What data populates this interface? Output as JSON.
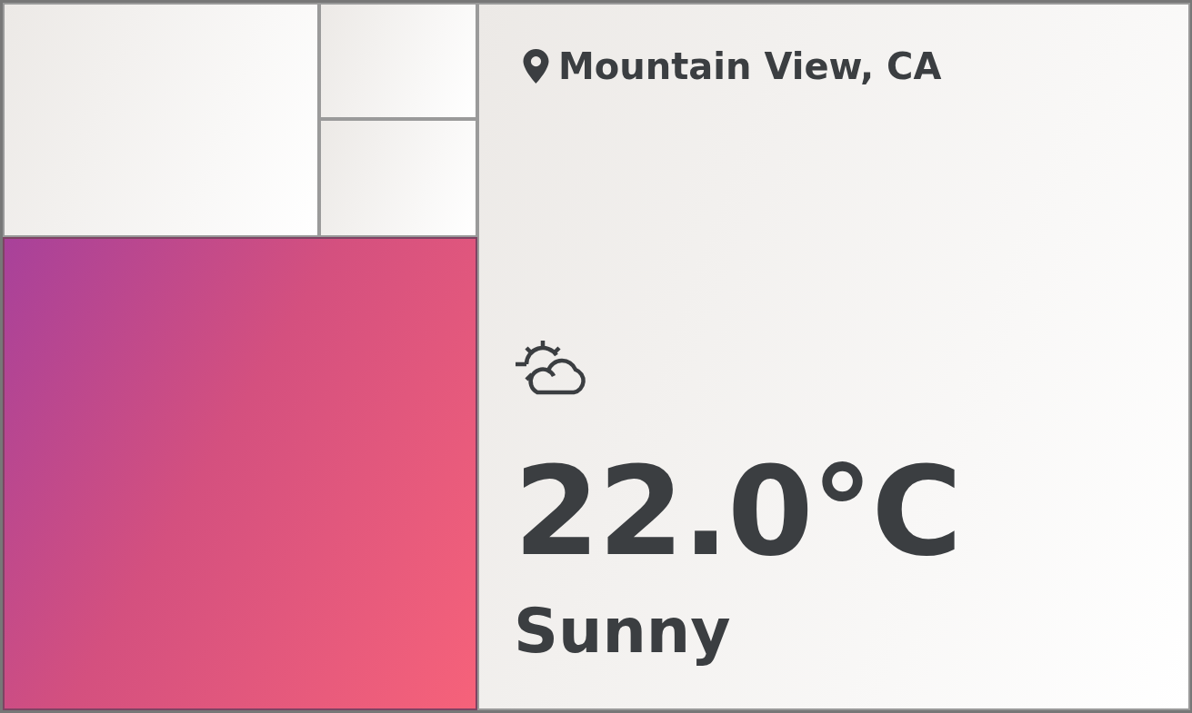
{
  "tiles": [
    {
      "kind": "plain"
    },
    {
      "kind": "plain"
    },
    {
      "kind": "plain"
    },
    {
      "kind": "gradient"
    }
  ],
  "weather": {
    "location": "Mountain View, CA",
    "temperature": "22.0°C",
    "condition": "Sunny"
  }
}
